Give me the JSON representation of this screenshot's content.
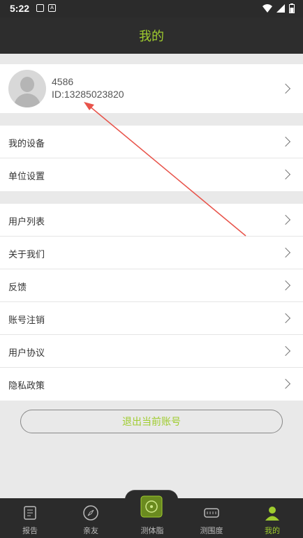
{
  "status_bar": {
    "time": "5:22"
  },
  "header": {
    "title": "我的"
  },
  "profile": {
    "name": "4586",
    "id_text": "ID:13285023820"
  },
  "menu_group_1": [
    {
      "label": "我的设备"
    },
    {
      "label": "单位设置"
    }
  ],
  "menu_group_2": [
    {
      "label": "用户列表"
    },
    {
      "label": "关于我们"
    },
    {
      "label": "反馈"
    },
    {
      "label": "账号注销"
    },
    {
      "label": "用户协议"
    },
    {
      "label": "隐私政策"
    }
  ],
  "logout_label": "退出当前账号",
  "tabs": [
    {
      "label": "报告",
      "icon": "report-icon"
    },
    {
      "label": "亲友",
      "icon": "compass-icon"
    },
    {
      "label": "测体脂",
      "icon": "scale-icon"
    },
    {
      "label": "测围度",
      "icon": "tape-measure-icon"
    },
    {
      "label": "我的",
      "icon": "person-icon",
      "active": true
    }
  ],
  "colors": {
    "accent": "#9fcc2e",
    "header_bg": "#2d2d2d",
    "annotation_arrow": "#e8534a"
  }
}
